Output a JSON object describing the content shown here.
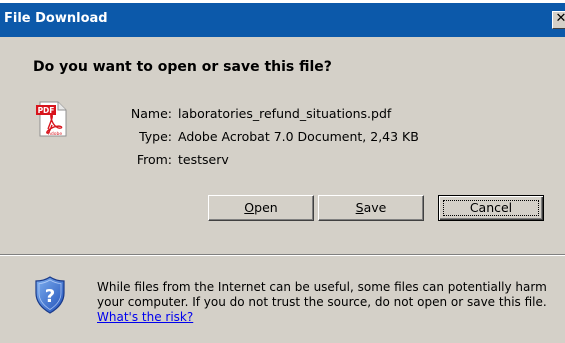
{
  "window": {
    "title": "File Download",
    "close_label": "✕"
  },
  "dialog": {
    "question": "Do you want to open or save this file?",
    "file_icon": "pdf-file-icon",
    "file_icon_text": "PDF",
    "file_icon_brand": "Adobe",
    "info": [
      {
        "label": "Name:",
        "value": "laboratories_refund_situations.pdf"
      },
      {
        "label": "Type:",
        "value": "Adobe Acrobat 7.0 Document, 2,43 KB"
      },
      {
        "label": "From:",
        "value": "testserv"
      }
    ],
    "buttons": {
      "open": "Open",
      "save": "Save",
      "cancel": "Cancel"
    }
  },
  "warning": {
    "icon": "shield-question-icon",
    "text": "While files from the Internet can be useful, some files can potentially harm your computer. If you do not trust the source, do not open or save this file.",
    "link": "What's the risk?"
  },
  "colors": {
    "titlebar": "#0c59aa",
    "dialog_bg": "#d4d0c8",
    "link": "#0000ee"
  }
}
